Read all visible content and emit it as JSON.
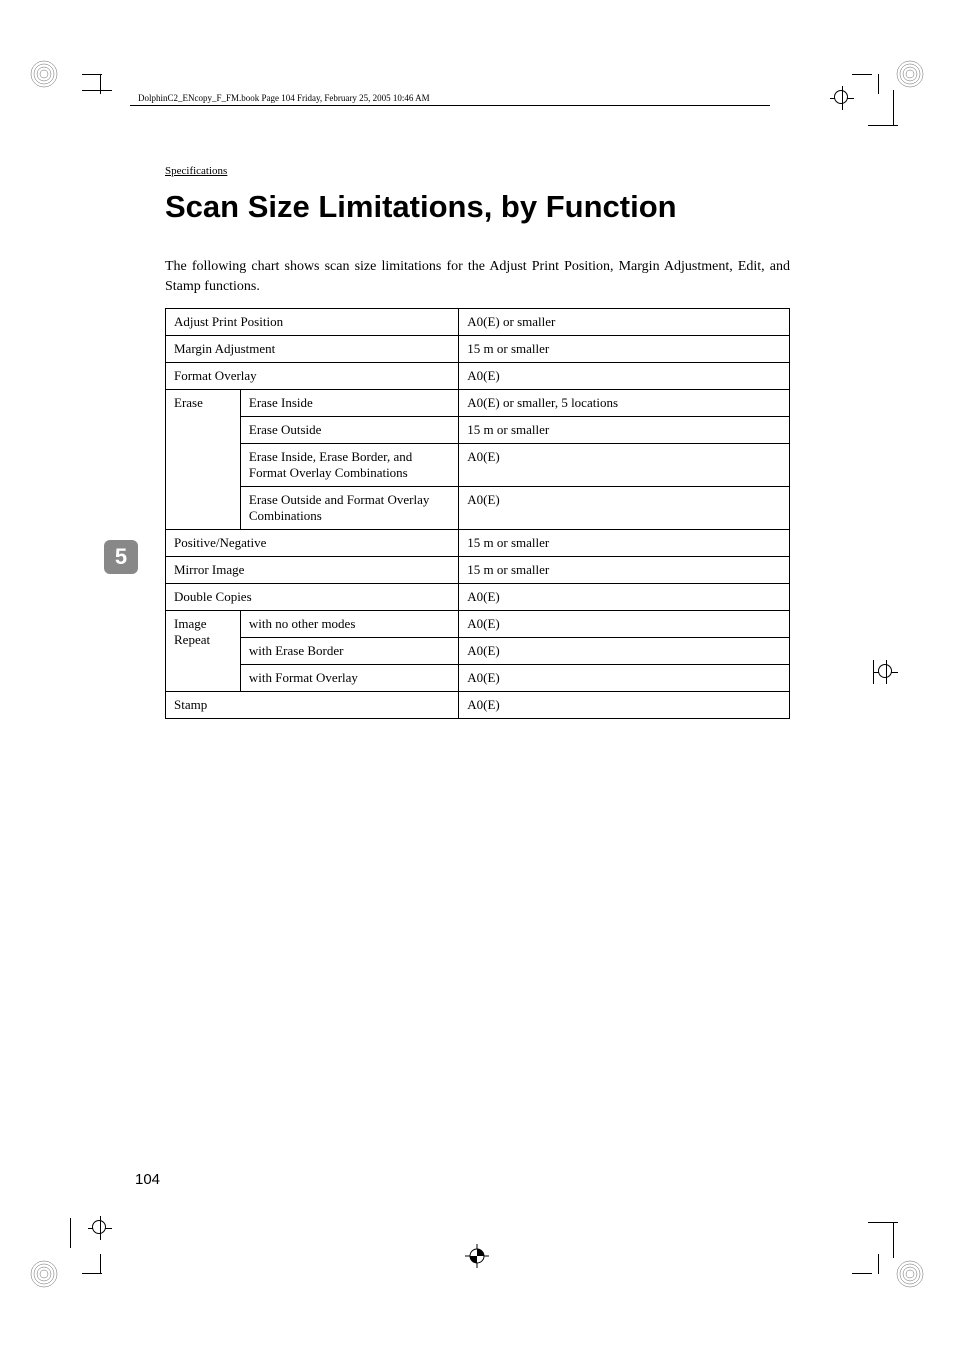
{
  "header": {
    "fileInfo": "DolphinC2_ENcopy_F_FM.book  Page 104  Friday, February 25, 2005  10:46 AM"
  },
  "section": "Specifications",
  "title": "Scan Size Limitations, by Function",
  "intro": "The following chart shows scan size limitations for the Adjust Print Position, Margin Adjustment, Edit, and Stamp functions.",
  "table": {
    "rows": [
      {
        "label": "Adjust Print Position",
        "value": "A0(E) or smaller"
      },
      {
        "label": "Margin Adjustment",
        "value": "15 m or smaller"
      },
      {
        "label": "Format Overlay",
        "value": "A0(E)"
      }
    ],
    "erase": {
      "label": "Erase",
      "items": [
        {
          "sub": "Erase Inside",
          "value": "A0(E) or smaller, 5 locations"
        },
        {
          "sub": "Erase Outside",
          "value": "15 m or smaller"
        },
        {
          "sub": "Erase Inside, Erase Border, and Format Overlay Combinations",
          "value": "A0(E)"
        },
        {
          "sub": "Erase Outside and Format Overlay Combinations",
          "value": "A0(E)"
        }
      ]
    },
    "rows2": [
      {
        "label": "Positive/Negative",
        "value": "15 m or smaller"
      },
      {
        "label": "Mirror Image",
        "value": "15 m or smaller"
      },
      {
        "label": "Double Copies",
        "value": "A0(E)"
      }
    ],
    "imageRepeat": {
      "label": "Image Repeat",
      "items": [
        {
          "sub": "with no other modes",
          "value": "A0(E)"
        },
        {
          "sub": "with Erase Border",
          "value": "A0(E)"
        },
        {
          "sub": "with Format Overlay",
          "value": "A0(E)"
        }
      ]
    },
    "stamp": {
      "label": "Stamp",
      "value": "A0(E)"
    }
  },
  "chapterNumber": "5",
  "pageNumber": "104"
}
